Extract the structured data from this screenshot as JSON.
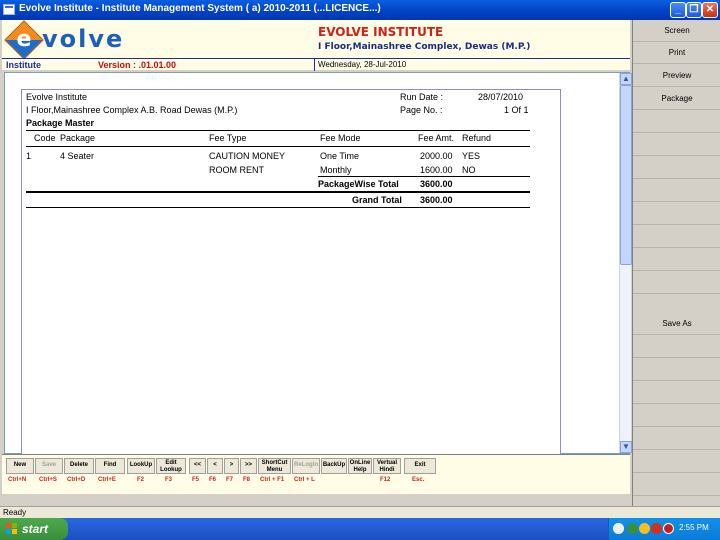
{
  "window": {
    "title": "Evolve Institute - Institute Management System ( a) 2010-2011 (...LICENCE...)",
    "min_glyph": "_",
    "max_glyph": "❐",
    "close_glyph": "✕"
  },
  "header": {
    "logo_letter": "e",
    "logo_text": "volve",
    "institute_name": "EVOLVE INSTITUTE",
    "institute_address": "I Floor,Mainashree Complex, Dewas (M.P.)",
    "module_label": "Institute",
    "version": "Version : .01.01.00",
    "date": "Wednesday, 28-Jul-2010"
  },
  "report": {
    "org_name": "Evolve Institute",
    "org_address": "I Floor,Mainashree Complex A.B. Road Dewas (M.P.)",
    "title": "Package Master",
    "run_date_label": "Run Date :",
    "run_date": "28/07/2010",
    "page_no_label": "Page No. :",
    "page_no": "1 Of 1",
    "columns": [
      "Code",
      "Package",
      "Fee Type",
      "Fee Mode",
      "Fee Amt.",
      "Refund"
    ],
    "rows": [
      {
        "code": "1",
        "package": "4 Seater",
        "fee_type": "CAUTION MONEY",
        "fee_mode": "One Time",
        "fee_amt": "2000.00",
        "refund": "YES"
      },
      {
        "code": "",
        "package": "",
        "fee_type": "ROOM RENT",
        "fee_mode": "Monthly",
        "fee_amt": "1600.00",
        "refund": "NO"
      }
    ],
    "packagewise_total_label": "PackageWise Total",
    "packagewise_total": "3600.00",
    "grand_total_label": "Grand Total",
    "grand_total": "3600.00"
  },
  "right_panel": {
    "buttons": [
      "Screen",
      "Print",
      "Preview",
      "Package",
      "Save As"
    ]
  },
  "toolbar": {
    "buttons": [
      {
        "label": "New",
        "key": "Ctrl+N"
      },
      {
        "label": "Save",
        "key": "Ctrl+S"
      },
      {
        "label": "Delete",
        "key": "Ctrl+D"
      },
      {
        "label": "Find",
        "key": "Ctrl+E"
      },
      {
        "label": "LookUp",
        "key": "F2"
      },
      {
        "label": "Edit Lookup",
        "key": "F3"
      },
      {
        "label": "<<",
        "key": "F5"
      },
      {
        "label": "<",
        "key": "F6"
      },
      {
        "label": ">",
        "key": "F7"
      },
      {
        "label": ">>",
        "key": "F8"
      },
      {
        "label": "ShortCut Menu",
        "key": "Ctrl + F1"
      },
      {
        "label": "ReLogin",
        "key": "Ctrl + L"
      },
      {
        "label": "BackUp",
        "key": ""
      },
      {
        "label": "OnLine Help",
        "key": ""
      },
      {
        "label": "Vertual Hindi",
        "key": "F12"
      },
      {
        "label": "Exit",
        "key": "Esc."
      }
    ]
  },
  "statusbar": {
    "text": "Ready"
  },
  "taskbar": {
    "start_label": "start",
    "clock": "2:55 PM"
  },
  "colors": {
    "title_blue": "#0344c8",
    "header_red": "#d0201a",
    "header_navy": "#1b2ea0",
    "header_bg": "#fffde6"
  }
}
